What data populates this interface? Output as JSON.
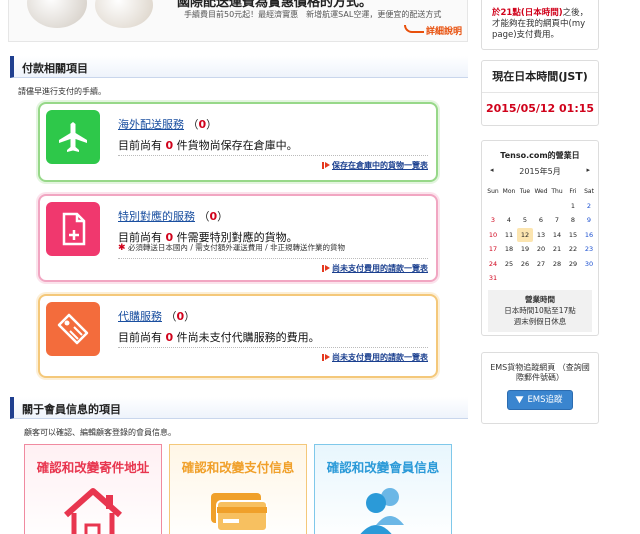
{
  "banner": {
    "headline": "國際配送運費為實惠價格的方式。",
    "subline": "手續費目前50元起！最經濟實惠　新增航運SAL空運，更便宜的配送方式",
    "more_label": "詳細說明"
  },
  "payment": {
    "heading": "付款相關項目",
    "description": "請儘早進行支付的手續。",
    "cards": [
      {
        "title": "海外配送服務",
        "count": "0",
        "msg_prefix": "目前尚有 ",
        "msg_suffix": " 件貨物尚保存在倉庫中。",
        "note": "",
        "link": "保存在倉庫中的貨物一覽表",
        "icon": "airplane-icon",
        "color": "#2ec84a"
      },
      {
        "title": "特別對應的服務",
        "count": "0",
        "msg_prefix": "目前尚有 ",
        "msg_suffix": " 件需要特別對應的貨物。",
        "note": "必須轉送日本國內 / 需支付額外運送費用 / 非正規轉送作業的貨物",
        "link": "尚未支付費用的請款一覽表",
        "icon": "document-add-icon",
        "color": "#f0386e"
      },
      {
        "title": "代購服務",
        "count": "0",
        "msg_prefix": "目前尚有 ",
        "msg_suffix": " 件尚未支付代購服務的費用。",
        "note": "",
        "link": "尚未支付費用的請款一覽表",
        "icon": "price-tag-icon",
        "color": "#f36c3c"
      }
    ]
  },
  "member": {
    "heading": "關于會員信息的項目",
    "description": "顧客可以確認、編輯顧客登錄的會員信息。",
    "boxes": [
      {
        "label": "確認和改變寄件地址",
        "icon": "house-icon"
      },
      {
        "label": "確認和改變支付信息",
        "icon": "credit-card-icon"
      },
      {
        "label": "確認和改變會員信息",
        "icon": "users-icon"
      }
    ]
  },
  "sidebar": {
    "notice_red": "於21點(日本時間)",
    "notice_rest_1": "之後，",
    "notice_rest_2": "才能夠在我的網頁中(my",
    "notice_rest_3": "page)支付費用。",
    "clock_heading": "現在日本時間(JST)",
    "clock_value": "2015/05/12 01:15",
    "calendar": {
      "heading": "Tenso.com的營業日",
      "month": "2015年5月",
      "prev": "◂",
      "next": "▸",
      "dow": [
        "Sun",
        "Mon",
        "Tue",
        "Wed",
        "Thu",
        "Fri",
        "Sat"
      ],
      "weeks": [
        [
          "",
          "",
          "",
          "",
          "",
          "1",
          "2"
        ],
        [
          "3",
          "4",
          "5",
          "6",
          "7",
          "8",
          "9"
        ],
        [
          "10",
          "11",
          "12",
          "13",
          "14",
          "15",
          "16"
        ],
        [
          "17",
          "18",
          "19",
          "20",
          "21",
          "22",
          "23"
        ],
        [
          "24",
          "25",
          "26",
          "27",
          "28",
          "29",
          "30"
        ],
        [
          "31",
          "",
          "",
          "",
          "",
          "",
          ""
        ]
      ],
      "today": "12",
      "hours_title": "營業時間",
      "hours_line1": "日本時間10點至17點",
      "hours_line2": "週末例假日休息"
    },
    "ems_text": "EMS貨物追蹤網頁 （查詢國際郵件號碼）",
    "ems_button": "EMS追蹤"
  }
}
